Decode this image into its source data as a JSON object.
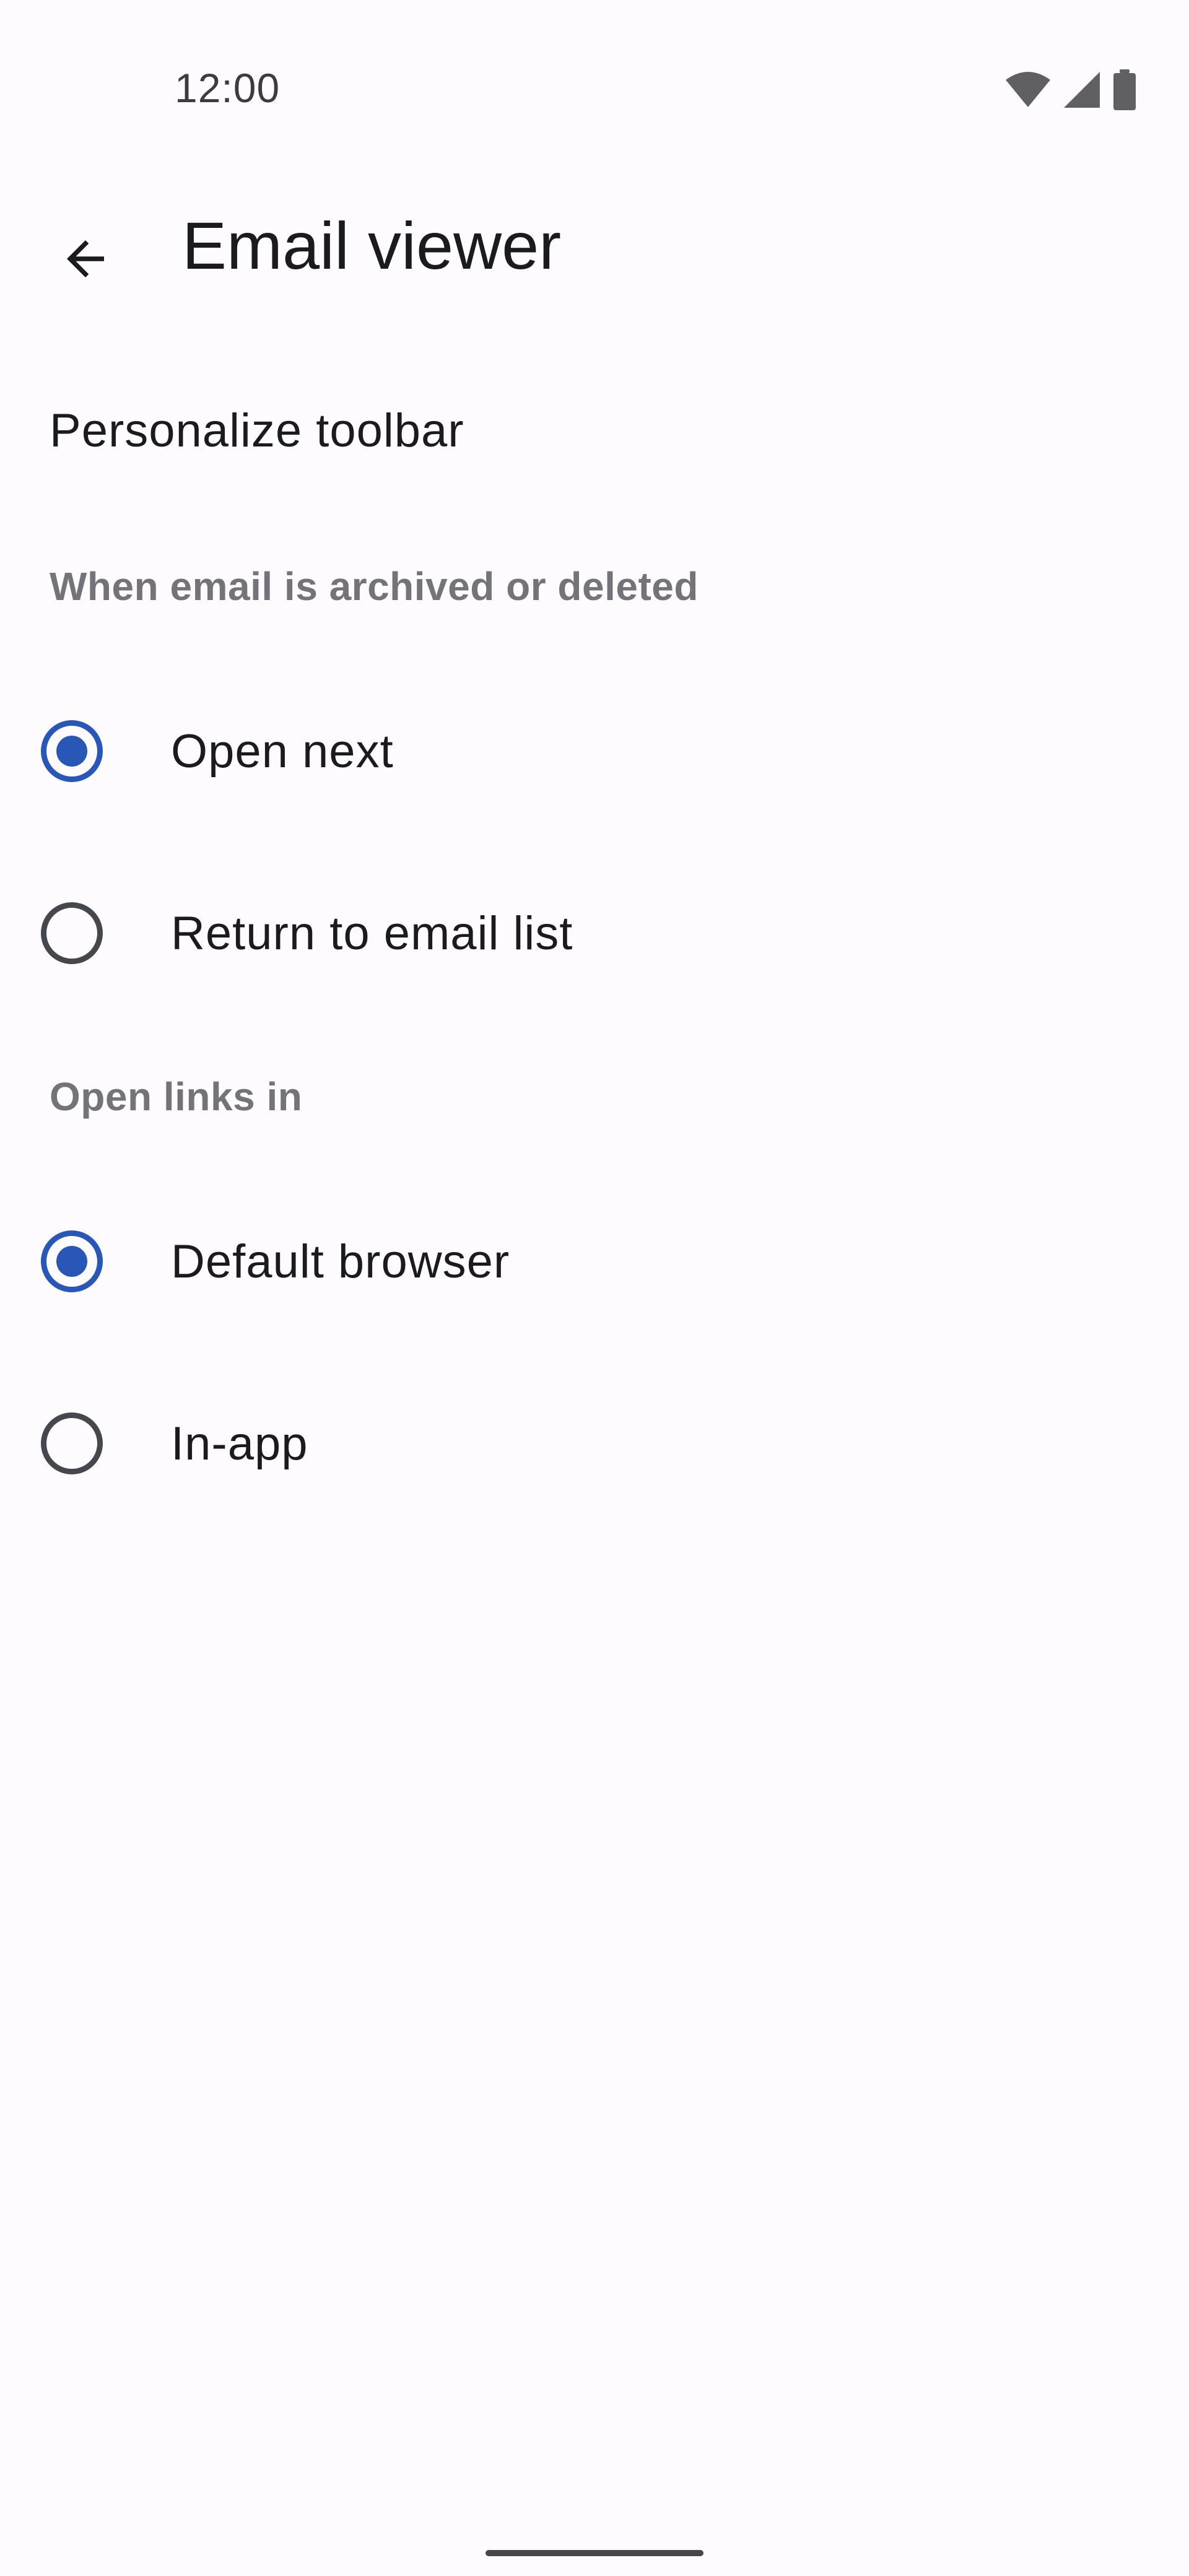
{
  "status_bar": {
    "time": "12:00",
    "icons": [
      "wifi-icon",
      "cell-signal-icon",
      "battery-icon"
    ]
  },
  "top_bar": {
    "back_icon": "arrow-back-icon",
    "title": "Email viewer"
  },
  "preferences": {
    "personalize_toolbar": "Personalize toolbar",
    "archive_section": {
      "header": "When email is archived or deleted",
      "options": [
        {
          "label": "Open next",
          "selected": true
        },
        {
          "label": "Return to email list",
          "selected": false
        }
      ]
    },
    "links_section": {
      "header": "Open links in",
      "options": [
        {
          "label": "Default browser",
          "selected": true
        },
        {
          "label": "In-app",
          "selected": false
        }
      ]
    }
  },
  "colors": {
    "background": "#fdfbfe",
    "accent": "#2857b8",
    "text_primary": "#1b1b1f",
    "text_secondary": "#74737a"
  }
}
